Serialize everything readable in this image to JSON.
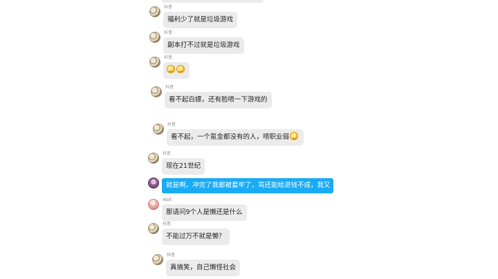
{
  "messages": [
    {
      "sender": "抖音",
      "text": "福利少了就是垃圾游戏"
    },
    {
      "sender": "抖音",
      "text": "副本打不过就是垃圾游戏"
    },
    {
      "sender": "抖音",
      "emoji": [
        "smirk-emoji",
        "smirk-emoji"
      ]
    },
    {
      "sender": "抖音",
      "text": "看不起白嫖，还有脸喷一下游戏的"
    },
    {
      "sender": "抖音",
      "text": "看不起，一个氪金都没有的人，喷职业弱",
      "emoji": [
        "smirk-emoji"
      ]
    },
    {
      "sender": "抖音",
      "text": "现在21世纪"
    },
    {
      "sender": "",
      "text": "就是啊，冲完了我都被套牢了，骂还能给退钱不成，我又"
    },
    {
      "sender": "Wait",
      "text": "那请问9个人是懒还是什么"
    },
    {
      "sender": "抖音",
      "text": "不能过万不就是懒？"
    },
    {
      "sender": "抖音",
      "text": "真搞笑，自己懒怪社会"
    }
  ],
  "colors": {
    "bubble_gray": "#ebebeb",
    "bubble_blue": "#1aabf5",
    "name_gray": "#8a8a8a"
  }
}
